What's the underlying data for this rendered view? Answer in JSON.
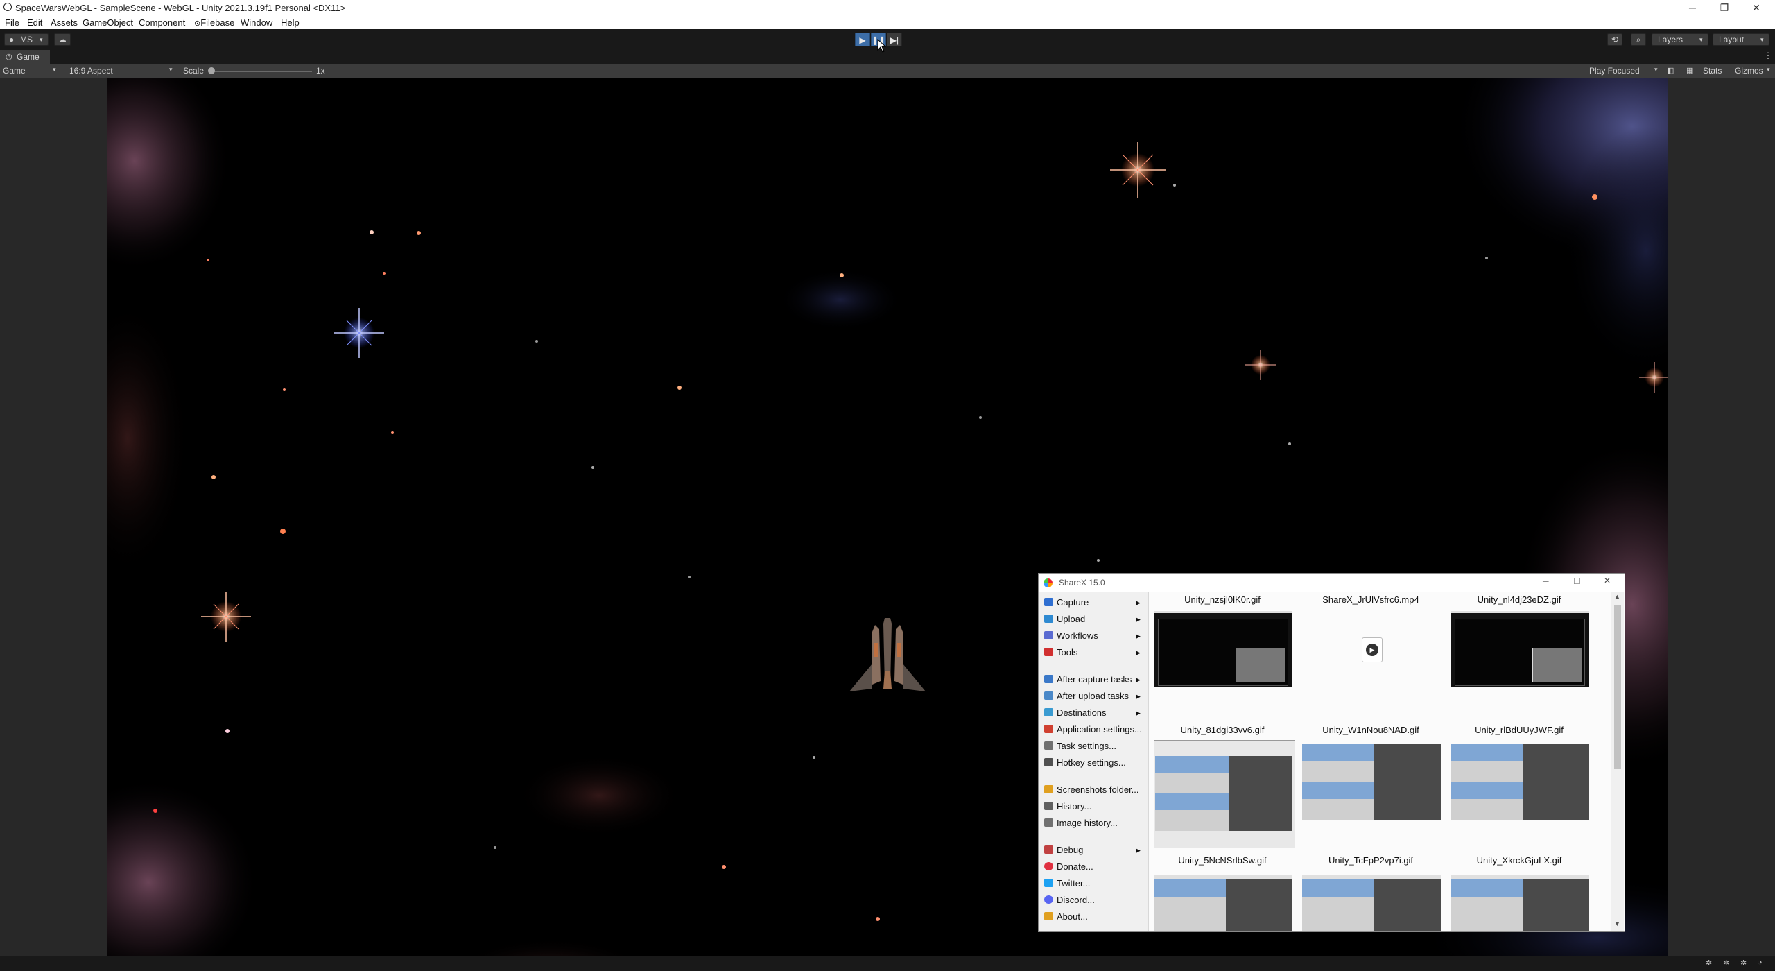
{
  "window": {
    "title": "SpaceWarsWebGL - SampleScene - WebGL - Unity 2021.3.19f1 Personal <DX11>",
    "controls": [
      "─",
      "❐",
      "✕"
    ]
  },
  "menubar": [
    "File",
    "Edit",
    "Assets",
    "GameObject",
    "Component",
    "Filebase",
    "Window",
    "Help"
  ],
  "toolbar": {
    "account_label": "MS",
    "layers_label": "Layers",
    "layout_label": "Layout"
  },
  "tab": {
    "label": "Game"
  },
  "game_toolbar": {
    "display_label": "Game",
    "aspect_label": "16:9 Aspect",
    "scale_label": "Scale",
    "scale_value": "1x",
    "play_mode_label": "Play Focused",
    "stats_label": "Stats",
    "gizmos_label": "Gizmos"
  },
  "sharex": {
    "title": "ShareX 15.0",
    "menu": [
      {
        "label": "Capture",
        "icon": "camera-icon",
        "color": "#2f6fd1",
        "submenu": true
      },
      {
        "label": "Upload",
        "icon": "upload-arrow-icon",
        "color": "#2f8ad1",
        "submenu": true
      },
      {
        "label": "Workflows",
        "icon": "grid-icon",
        "color": "#5a6bd1",
        "submenu": true
      },
      {
        "label": "Tools",
        "icon": "toolbox-icon",
        "color": "#d13030",
        "submenu": true
      },
      {
        "label": "After capture tasks",
        "icon": "image-gear-icon",
        "color": "#3a78c8",
        "submenu": true
      },
      {
        "label": "After upload tasks",
        "icon": "cloud-icon",
        "color": "#4a88c8",
        "submenu": true
      },
      {
        "label": "Destinations",
        "icon": "globe-icon",
        "color": "#3a9bd1",
        "submenu": true
      },
      {
        "label": "Application settings...",
        "icon": "wrench-icon",
        "color": "#d04030",
        "submenu": false
      },
      {
        "label": "Task settings...",
        "icon": "gear-icon",
        "color": "#707070",
        "submenu": false
      },
      {
        "label": "Hotkey settings...",
        "icon": "keyboard-icon",
        "color": "#505050",
        "submenu": false
      },
      {
        "label": "Screenshots folder...",
        "icon": "folder-icon",
        "color": "#e0a020",
        "submenu": false
      },
      {
        "label": "History...",
        "icon": "history-icon",
        "color": "#606060",
        "submenu": false
      },
      {
        "label": "Image history...",
        "icon": "image-history-icon",
        "color": "#707070",
        "submenu": false
      },
      {
        "label": "Debug",
        "icon": "bug-icon",
        "color": "#c04040",
        "submenu": true
      },
      {
        "label": "Donate...",
        "icon": "heart-icon",
        "color": "#e03040",
        "submenu": false
      },
      {
        "label": "Twitter...",
        "icon": "twitter-icon",
        "color": "#1da1f2",
        "submenu": false
      },
      {
        "label": "Discord...",
        "icon": "discord-icon",
        "color": "#5865f2",
        "submenu": false
      },
      {
        "label": "About...",
        "icon": "crown-icon",
        "color": "#e0a020",
        "submenu": false
      }
    ],
    "thumbnails": [
      {
        "name": "Unity_nzsjl0lK0r.gif",
        "kind": "dark"
      },
      {
        "name": "ShareX_JrUlVsfrc6.mp4",
        "kind": "video"
      },
      {
        "name": "Unity_nl4dj23eDZ.gif",
        "kind": "dark"
      },
      {
        "name": "Unity_81dgi33vv6.gif",
        "kind": "light"
      },
      {
        "name": "Unity_W1nNou8NAD.gif",
        "kind": "light"
      },
      {
        "name": "Unity_rlBdUUyJWF.gif",
        "kind": "light"
      },
      {
        "name": "Unity_5NcNSrlbSw.gif",
        "kind": "light"
      },
      {
        "name": "Unity_TcFpP2vp7i.gif",
        "kind": "light"
      },
      {
        "name": "Unity_XkrckGjuLX.gif",
        "kind": "light"
      }
    ]
  }
}
